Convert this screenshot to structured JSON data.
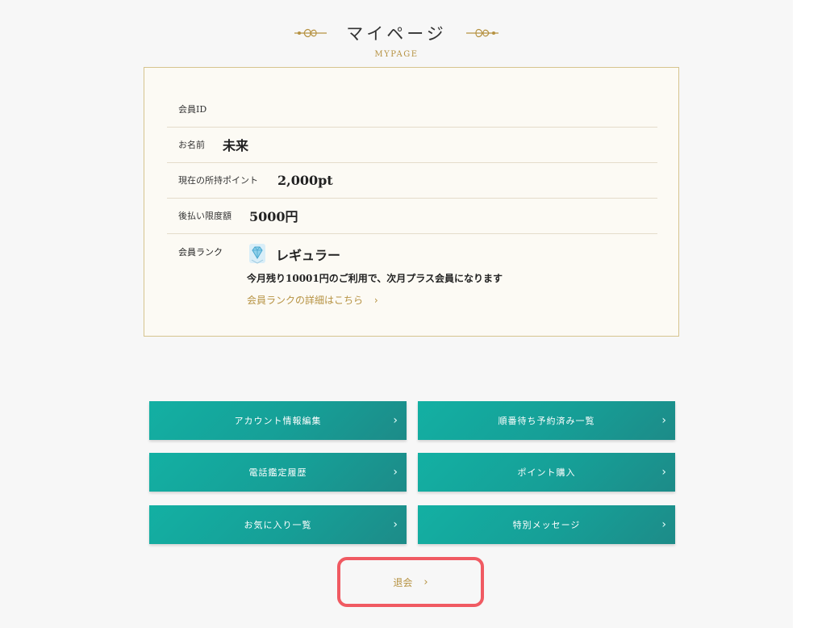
{
  "header": {
    "title": "マイページ",
    "subtitle": "MYPAGE"
  },
  "member": {
    "id_label": "会員ID",
    "id_value": "",
    "name_label": "お名前",
    "name_value": "未来",
    "points_label": "現在の所持ポイント",
    "points_value": "2,000pt",
    "deferred_label": "後払い限度額",
    "deferred_value": "5000円",
    "rank_label": "会員ランク",
    "rank_name": "レギュラー",
    "rank_note": "今月残り10001円のご利用で、次月プラス会員になります",
    "rank_link": "会員ランクの詳細はこちら",
    "rank_link_chevron": "›",
    "rank_icon": "diamond-badge-icon"
  },
  "menu": {
    "account_edit": "アカウント情報編集",
    "queue_reserved": "順番待ち予約済み一覧",
    "call_history": "電話鑑定履歴",
    "point_purchase": "ポイント購入",
    "favorites": "お気に入り一覧",
    "special_message": "特別メッセージ",
    "chevron": "›"
  },
  "withdraw": {
    "label": "退会",
    "chevron": "›",
    "highlight_color": "#f05a62"
  },
  "colors": {
    "accent_gold": "#b69242",
    "button_teal": "#16a59c",
    "card_border": "#d6c48e",
    "card_bg": "#fcfaf4"
  }
}
